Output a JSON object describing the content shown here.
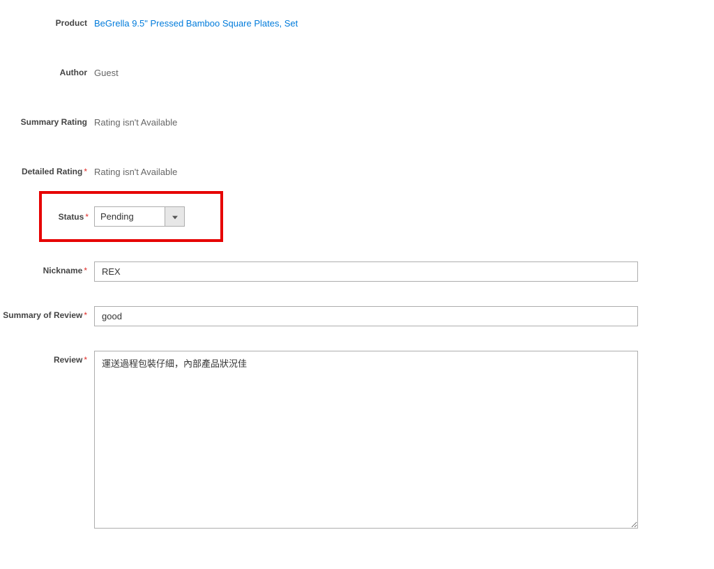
{
  "labels": {
    "product": "Product",
    "author": "Author",
    "summary_rating": "Summary Rating",
    "detailed_rating": "Detailed Rating",
    "status": "Status",
    "nickname": "Nickname",
    "summary_of_review": "Summary of Review",
    "review": "Review"
  },
  "values": {
    "product": "BeGrella 9.5\" Pressed Bamboo Square Plates, Set",
    "author": "Guest",
    "summary_rating": "Rating isn't Available",
    "detailed_rating": "Rating isn't Available",
    "status": "Pending",
    "nickname": "REX",
    "summary_of_review": "good",
    "review": "運送過程包裝仔細，內部產品狀況佳"
  },
  "required_marker": "*"
}
